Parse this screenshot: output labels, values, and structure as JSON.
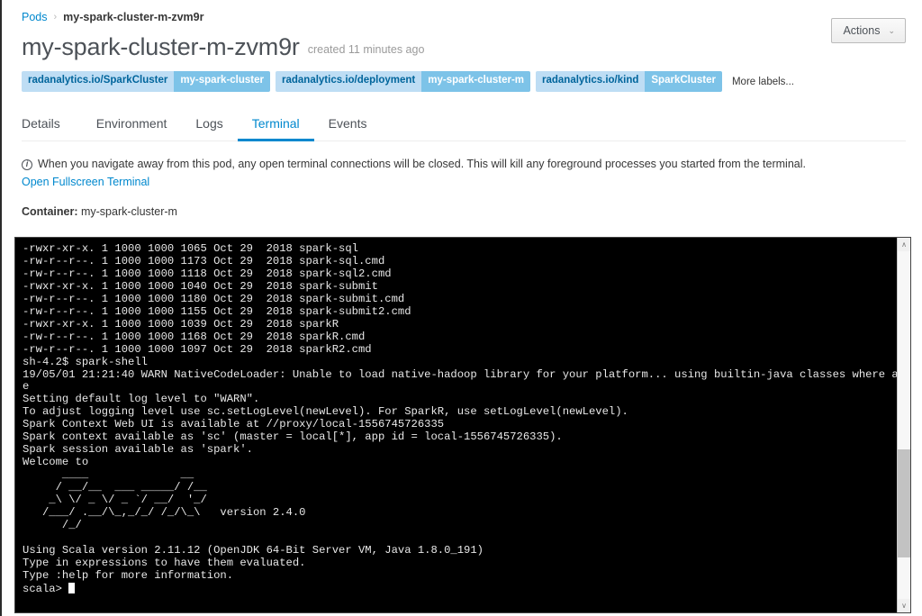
{
  "breadcrumb": {
    "parent": "Pods",
    "separator": "›",
    "current": "my-spark-cluster-m-zvm9r"
  },
  "header": {
    "title": "my-spark-cluster-m-zvm9r",
    "created_meta": "created 11 minutes ago",
    "actions_label": "Actions",
    "actions_caret": "⌄"
  },
  "labels": {
    "chips": [
      {
        "key": "radanalytics.io/SparkCluster",
        "value": "my-spark-cluster"
      },
      {
        "key": "radanalytics.io/deployment",
        "value": "my-spark-cluster-m"
      },
      {
        "key": "radanalytics.io/kind",
        "value": "SparkCluster"
      }
    ],
    "more": "More labels..."
  },
  "tabs": [
    {
      "label": "Details",
      "active": false
    },
    {
      "label": "Environment",
      "active": false
    },
    {
      "label": "Logs",
      "active": false
    },
    {
      "label": "Terminal",
      "active": true
    },
    {
      "label": "Events",
      "active": false
    }
  ],
  "notice": {
    "text": "When you navigate away from this pod, any open terminal connections will be closed. This will kill any foreground processes you started from the terminal.",
    "fullscreen_link": "Open Fullscreen Terminal"
  },
  "container": {
    "label": "Container:",
    "name": "my-spark-cluster-m"
  },
  "terminal": {
    "prompt": "scala>",
    "content": "-rwxr-xr-x. 1 1000 1000 1065 Oct 29  2018 spark-sql\n-rw-r--r--. 1 1000 1000 1173 Oct 29  2018 spark-sql.cmd\n-rw-r--r--. 1 1000 1000 1118 Oct 29  2018 spark-sql2.cmd\n-rwxr-xr-x. 1 1000 1000 1040 Oct 29  2018 spark-submit\n-rw-r--r--. 1 1000 1000 1180 Oct 29  2018 spark-submit.cmd\n-rw-r--r--. 1 1000 1000 1155 Oct 29  2018 spark-submit2.cmd\n-rwxr-xr-x. 1 1000 1000 1039 Oct 29  2018 sparkR\n-rw-r--r--. 1 1000 1000 1168 Oct 29  2018 sparkR.cmd\n-rw-r--r--. 1 1000 1000 1097 Oct 29  2018 sparkR2.cmd\nsh-4.2$ spark-shell\n19/05/01 21:21:40 WARN NativeCodeLoader: Unable to load native-hadoop library for your platform... using builtin-java classes where applicabl\ne\nSetting default log level to \"WARN\".\nTo adjust logging level use sc.setLogLevel(newLevel). For SparkR, use setLogLevel(newLevel).\nSpark Context Web UI is available at //proxy/local-1556745726335\nSpark context available as 'sc' (master = local[*], app id = local-1556745726335).\nSpark session available as 'spark'.\nWelcome to\n      ____              __\n     / __/__  ___ _____/ /__\n    _\\ \\/ _ \\/ _ `/ __/  '_/\n   /___/ .__/\\_,_/_/ /_/\\_\\   version 2.4.0\n      /_/\n\nUsing Scala version 2.11.12 (OpenJDK 64-Bit Server VM, Java 1.8.0_191)\nType in expressions to have them evaluated.\nType :help for more information.\n"
  },
  "scrollbar": {
    "up_arrow": "∧",
    "down_arrow": "∨"
  }
}
